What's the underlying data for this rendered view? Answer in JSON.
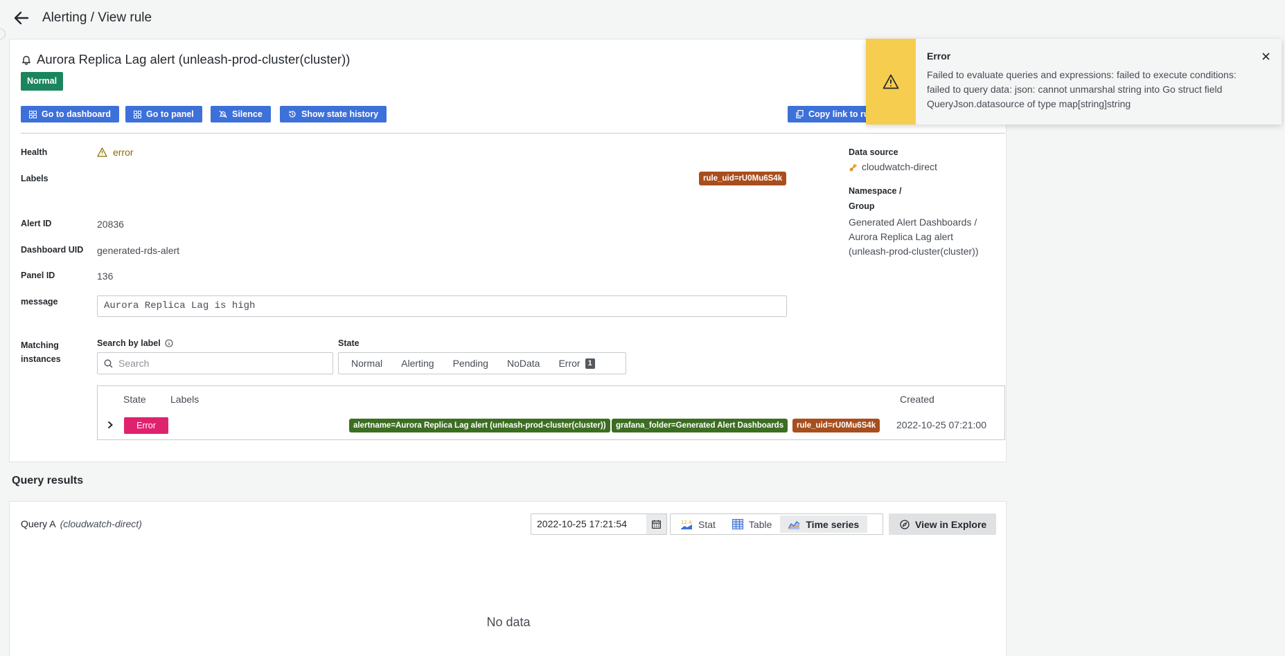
{
  "header": {
    "breadcrumb": "Alerting / View rule"
  },
  "rule": {
    "title": "Aurora Replica Lag alert (unleash-prod-cluster(cluster))",
    "state_badge": "Normal"
  },
  "actions": {
    "go_to_dashboard": "Go to dashboard",
    "go_to_panel": "Go to panel",
    "silence": "Silence",
    "show_state_history": "Show state history",
    "copy_link": "Copy link to rule"
  },
  "details": {
    "health_label": "Health",
    "health_value": "error",
    "labels_label": "Labels",
    "labels": [
      "rule_uid=rU0Mu6S4k"
    ],
    "alert_id_label": "Alert ID",
    "alert_id": "20836",
    "dashboard_uid_label": "Dashboard UID",
    "dashboard_uid": "generated-rds-alert",
    "panel_id_label": "Panel ID",
    "panel_id": "136",
    "message_label": "message",
    "message": "Aurora Replica Lag is high"
  },
  "side": {
    "data_source_label": "Data source",
    "data_source": "cloudwatch-direct",
    "namespace_label_1": "Namespace /",
    "namespace_label_2": "Group",
    "namespace_line_1": "Generated Alert Dashboards /",
    "namespace_line_2": "Aurora Replica Lag alert",
    "namespace_line_3": "(unleash-prod-cluster(cluster))"
  },
  "instances": {
    "section_label_1": "Matching",
    "section_label_2": "instances",
    "search_label": "Search by label",
    "search_placeholder": "Search",
    "state_label": "State",
    "state_filters": [
      "Normal",
      "Alerting",
      "Pending",
      "NoData",
      "Error"
    ],
    "error_count": "1",
    "columns": {
      "state": "State",
      "labels": "Labels",
      "created": "Created"
    },
    "rows": [
      {
        "state": "Error",
        "labels": [
          "alertname=Aurora Replica Lag alert (unleash-prod-cluster(cluster))",
          "grafana_folder=Generated Alert Dashboards",
          "rule_uid=rU0Mu6S4k"
        ],
        "created": "2022-10-25 07:21:00"
      }
    ]
  },
  "query_results": {
    "title": "Query results",
    "query_name": "Query A",
    "query_source": "(cloudwatch-direct)",
    "time_value": "2022-10-25 17:21:54",
    "view_options": [
      "Stat",
      "Table",
      "Time series"
    ],
    "active_view": "Time series",
    "explore_button": "View in Explore",
    "no_data": "No data"
  },
  "toast": {
    "title": "Error",
    "message": "Failed to evaluate queries and expressions: failed to execute conditions: failed to query data: json: cannot unmarshal string into Go struct field QueryJson.datasource of type map[string]string"
  },
  "colors": {
    "primary": "#3d71d9",
    "normal_badge": "#1b855e",
    "error_badge": "#e0226e",
    "label_orange": "#a84e1d",
    "label_green": "#3c6e22",
    "warning": "#f6cd4e"
  }
}
